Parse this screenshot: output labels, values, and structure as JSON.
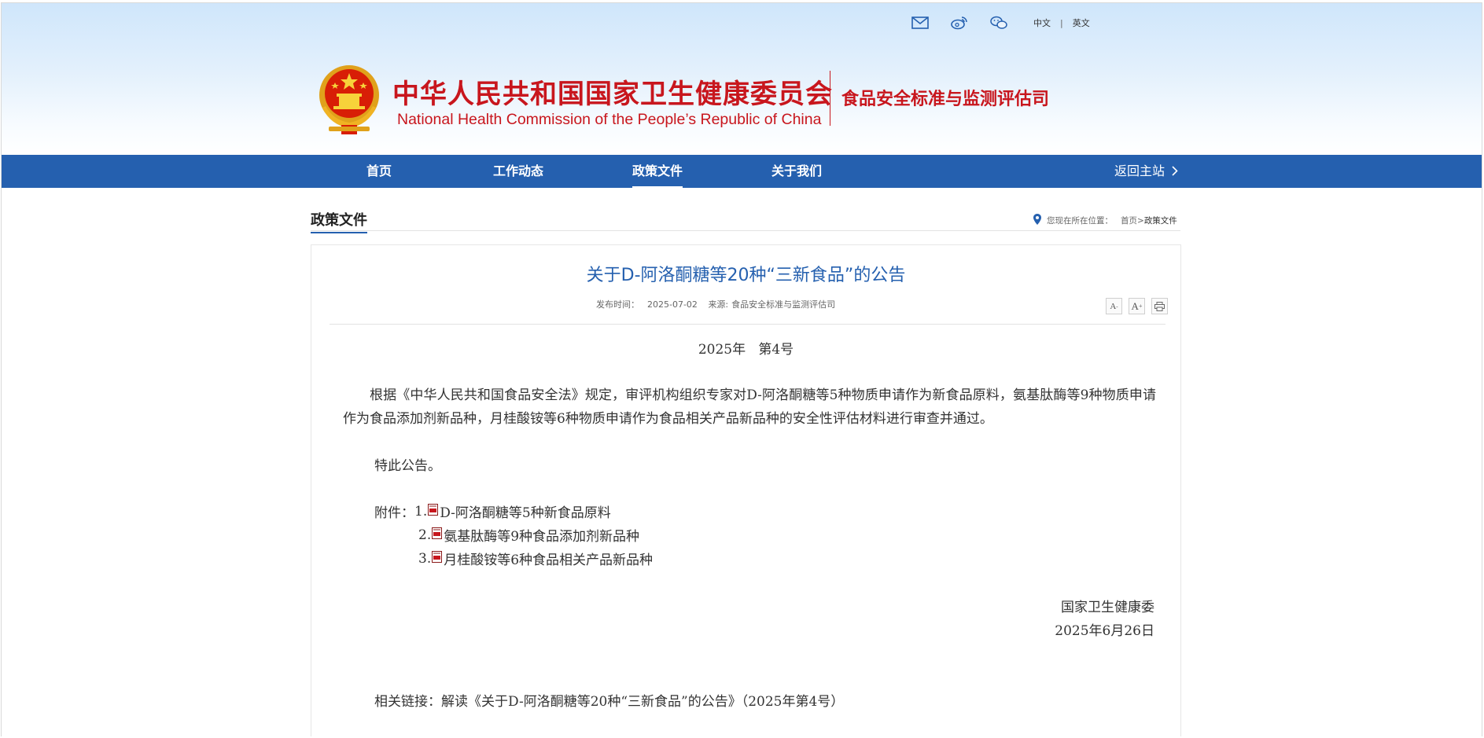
{
  "header": {
    "title_cn": "中华人民共和国国家卫生健康委员会",
    "title_en": "National Health Commission of the People’s  Republic of China",
    "department": "食品安全标准与监测评估司",
    "lang_cn": "中文",
    "lang_sep": "|",
    "lang_en": "英文",
    "brand_color": "#c8161d"
  },
  "nav": {
    "items": [
      {
        "label": "首页"
      },
      {
        "label": "工作动态"
      },
      {
        "label": "政策文件"
      },
      {
        "label": "关于我们"
      }
    ],
    "active": "政策文件",
    "back_label": "返回主站",
    "bar_color": "#2560af"
  },
  "section": {
    "title": "政策文件",
    "crumb_prefix": "您现在所在位置：",
    "crumb_home": "首页",
    "crumb_sep": ">",
    "crumb_current": "政策文件"
  },
  "article": {
    "title": "关于D-阿洛酮糖等20种“三新食品”的公告",
    "publish_label": "发布时间：",
    "publish_date": "2025-07-02",
    "source_label": "来源:",
    "source": "食品安全标准与监测评估司",
    "tools": {
      "font_smaller": "A",
      "font_larger": "A"
    },
    "doc_number": "2025年   第4号",
    "paragraph": "根据《中华人民共和国食品安全法》规定，审评机构组织专家对D-阿洛酮糖等5种物质申请作为新食品原料，氨基肽酶等9种物质申请作为食品添加剂新品种，月桂酸铵等6种物质申请作为食品相关产品新品种的安全性评估材料进行审查并通过。",
    "notice": "特此公告。",
    "attachments_label": "附件：",
    "attachments": [
      {
        "num": "1.",
        "title": "D-阿洛酮糖等5种新食品原料"
      },
      {
        "num": "2.",
        "title": "氨基肽酶等9种食品添加剂新品种"
      },
      {
        "num": "3.",
        "title": "月桂酸铵等6种食品相关产品新品种"
      }
    ],
    "signature_org": "国家卫生健康委",
    "signature_date": "2025年6月26日",
    "related_label": "相关链接：",
    "related_link": "解读《关于D-阿洛酮糖等20种“三新食品”的公告》（2025年第4号）"
  },
  "icons": [
    "mail-icon",
    "weibo-icon",
    "wechat-icon",
    "location-pin-icon",
    "font-smaller-icon",
    "font-larger-icon",
    "print-icon",
    "pdf-icon"
  ]
}
